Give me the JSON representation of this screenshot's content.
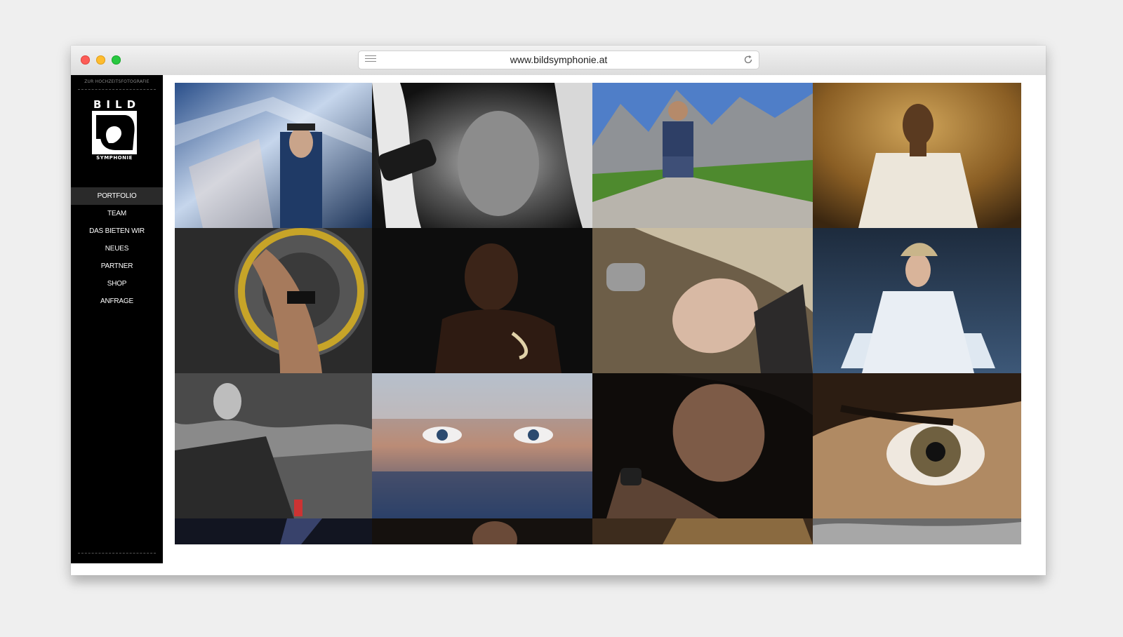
{
  "browser": {
    "url": "www.bildsymphonie.at",
    "controls": [
      "close",
      "minimize",
      "zoom"
    ],
    "reader_icon": "reader-list-icon",
    "reload_icon": "reload-icon"
  },
  "site": {
    "tagline": "ZUR HOCHZEITSFOTOGRAFIE",
    "logo_top": "BILD",
    "logo_bottom": "SYMPHONIE"
  },
  "nav": {
    "items": [
      {
        "label": "PORTFOLIO",
        "active": true
      },
      {
        "label": "TEAM",
        "active": false
      },
      {
        "label": "DAS BIETEN WIR",
        "active": false
      },
      {
        "label": "NEUES",
        "active": false
      },
      {
        "label": "PARTNER",
        "active": false
      },
      {
        "label": "SHOP",
        "active": false
      },
      {
        "label": "ANFRAGE",
        "active": false
      }
    ]
  },
  "colors": {
    "sidebar_bg": "#000000",
    "active_nav_bg": "#2a2a2a",
    "page_bg": "#efefef"
  }
}
